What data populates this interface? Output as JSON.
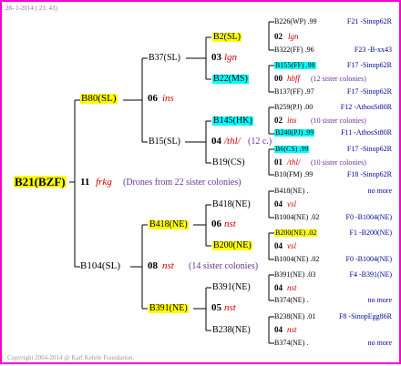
{
  "header": "28- 1-2014 ( 23: 43)",
  "footer": "Copyright 2004-2014 @ Karl Kehrle Foundation.",
  "colors": {
    "border": "#ff00cc",
    "yellow": "#ffff00",
    "cyan": "#00ffff",
    "red": "#cc0000",
    "blue": "#000099",
    "purple": "#663399"
  },
  "root": {
    "label": "B21(BZF)"
  },
  "gen1": {
    "sire": "B80(SL)",
    "sire_num": "06",
    "sire_line": "ins",
    "mid_num": "11",
    "mid_line": "frkg",
    "mid_note": "(Drones from 22 sister colonies)",
    "dam": "B104(SL)",
    "dam_num": "08",
    "dam_line": "nst",
    "dam_note": "(14 sister colonies)"
  },
  "gen2": {
    "a": "B37(SL)",
    "a_num": "03",
    "a_line": "lgn",
    "b": "B15(SL)",
    "b_num": "04",
    "b_line": "/thl/",
    "b_note": "(12 c.)",
    "c": "B418(NE)",
    "c_num": "06",
    "c_line": "nst",
    "d": "B391(NE)",
    "d_num": "05",
    "d_line": "nst"
  },
  "gen3": {
    "a1": "B2(SL)",
    "a1_num": "02",
    "a1_line": "lgn",
    "a2": "B22(MS)",
    "a2_num": "00",
    "a2_line": "hbff",
    "a2_note": "(12 sister colonies)",
    "b1": "B145(HK)",
    "b1_num": "02",
    "b1_line": "ins",
    "b1_note": "(10 sister colonies)",
    "b2": "B19(CS)",
    "b2_num": "01",
    "b2_line": "/thl/",
    "b2_note": "(10 sister colonies)",
    "c1": "B418(NE)",
    "c1_num": "04",
    "c1_line": "vsl",
    "c2": "B200(NE)",
    "c2_num": "04",
    "c2_line": "vsl",
    "d1": "B391(NE)",
    "d1_num": "04",
    "d1_line": "nst",
    "d2": "B238(NE)",
    "d2_num": "04",
    "d2_line": "nst"
  },
  "gen4": [
    {
      "left": "B226(WP) .99",
      "right": "F21 -Sinop62R"
    },
    {
      "left": "B322(FF) .96",
      "right": "F23 -B-xx43"
    },
    {
      "left": "B155(FF) .98",
      "right": "F17 -Sinop62R"
    },
    {
      "left": "B137(FF) .97",
      "right": "F17 -Sinop62R"
    },
    {
      "left": "B259(PJ) .00",
      "right": "F12 -AthosSt80R"
    },
    {
      "left": "B240(PJ) .99",
      "right": "F11 -AthosSt80R"
    },
    {
      "left": "B6(CS) .99",
      "right": "F17 -Sinop62R"
    },
    {
      "left": "B10(FM) .99",
      "right": "F18 -Sinop62R"
    },
    {
      "left": "B418(NE) .",
      "right": "no more"
    },
    {
      "left": "B1004(NE) .02",
      "right": "F0 -B1004(NE)"
    },
    {
      "left": "B200(NE) .02",
      "right": "F1 -B200(NE)"
    },
    {
      "left": "B1004(NE) .02",
      "right": "F0 -B1004(NE)"
    },
    {
      "left": "B391(NE) .03",
      "right": "F4 -B391(NE)"
    },
    {
      "left": "B374(NE) .",
      "right": "no more"
    },
    {
      "left": "B238(NE) .01",
      "right": "F8 -SinopEgg86R"
    },
    {
      "left": "B374(NE) .",
      "right": "no more"
    }
  ]
}
